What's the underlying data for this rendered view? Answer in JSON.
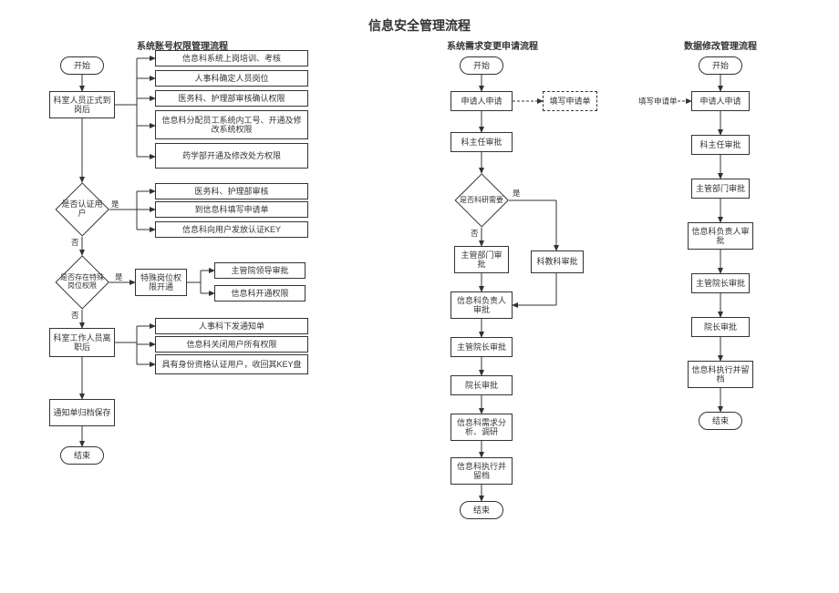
{
  "main_title": "信息安全管理流程",
  "column_a": {
    "title": "系统账号权限管理流程",
    "start": "开始",
    "staff_on": "科室人员正式到岗后",
    "branch1": [
      "信息科系统上岗培训、考核",
      "人事科确定人员岗位",
      "医务科、护理部审核确认权限",
      "信息科分配员工系统内工号、开通及修改系统权限",
      "药学部开通及修改处方权限"
    ],
    "d1": "是否认证用户",
    "d1_yes": "是",
    "d1_no": "否",
    "branch2": [
      "医务科、护理部审核",
      "到信息科填写申请单",
      "信息科向用户发放认证KEY"
    ],
    "d2": "是否存在特殊岗位权限",
    "d2_yes": "是",
    "d2_no": "否",
    "special": "特殊岗位权限开通",
    "branch3": [
      "主管院领导审批",
      "信息科开通权限"
    ],
    "staff_off": "科室工作人员离职后",
    "branch4": [
      "人事科下发通知单",
      "信息科关闭用户所有权限",
      "具有身份资格认证用户，收回其KEY盘"
    ],
    "archive": "通知单归档保存",
    "end": "结束"
  },
  "column_b": {
    "title": "系统需求变更申请流程",
    "start": "开始",
    "apply": "申请人申请",
    "fill": "填写申请单",
    "dir": "科主任审批",
    "d1": "是否科研需要",
    "d1_yes": "是",
    "d1_no": "否",
    "dept": "主管部门审批",
    "sci": "科教科审批",
    "info_lead": "信息科负责人审批",
    "vp": "主管院长审批",
    "pres": "院长审批",
    "analyze": "信息科需求分析、调研",
    "exec": "信息科执行并留档",
    "end": "结束"
  },
  "column_c": {
    "title": "数据修改管理流程",
    "start": "开始",
    "fill": "填写申请单",
    "apply": "申请人申请",
    "dir": "科主任审批",
    "dept": "主管部门审批",
    "info_lead": "信息科负责人审批",
    "vp": "主管院长审批",
    "pres": "院长审批",
    "exec": "信息科执行并留档",
    "end": "结束"
  }
}
